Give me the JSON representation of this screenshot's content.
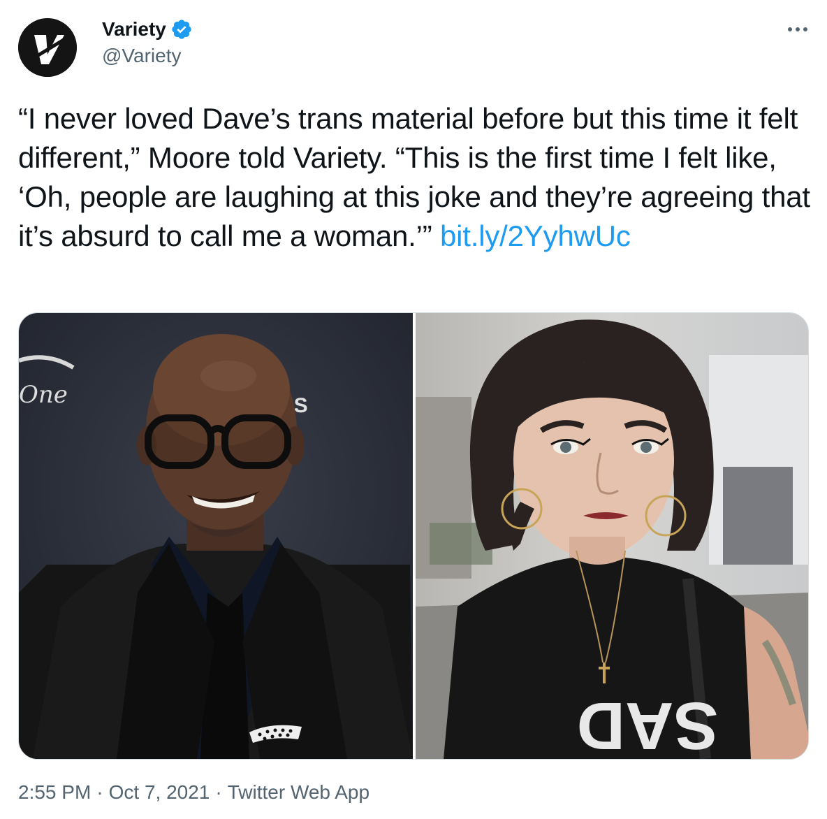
{
  "tweet": {
    "author": {
      "display_name": "Variety",
      "handle": "@Variety",
      "verified": true,
      "avatar_icon": "variety-logo-v",
      "verified_icon": "verified-badge-icon"
    },
    "more_icon": "more-options-icon",
    "text": "“I never loved Dave’s trans material before but this time it felt different,” Moore told Variety. “This is the first time I felt like, ‘Oh, people are laughing at this joke and they’re agreeing that it’s absurd to call me a woman.’” ",
    "link": "bit.ly/2YyhwUc",
    "media": {
      "left_photo_text": [
        "One",
        "BS"
      ],
      "right_photo_text": "SAD"
    },
    "timestamp": {
      "time": "2:55 PM",
      "date": "Oct 7, 2021",
      "source": "Twitter Web App"
    },
    "colors": {
      "link": "#1d9bf0",
      "verified": "#1d9bf0",
      "secondary_text": "#536471"
    }
  }
}
